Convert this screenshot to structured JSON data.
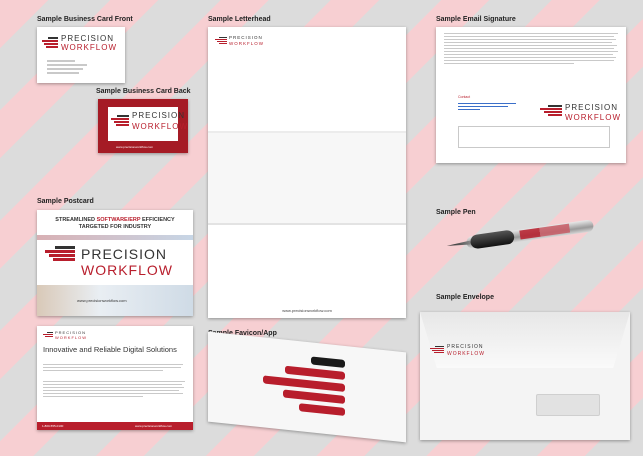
{
  "labels": {
    "card_front": "Sample Business Card Front",
    "card_back": "Sample Business Card Back",
    "letterhead": "Sample Letterhead",
    "email_signature": "Sample Email Signature",
    "postcard": "Sample Postcard",
    "pen": "Sample Pen",
    "envelope": "Sample Envelope",
    "favicon": "Sample Favicon/App"
  },
  "brand": {
    "word1": "PRECISION",
    "word2": "WORKFLOW",
    "website": "www.precisionworkflow.com",
    "colors": {
      "red": "#b81e2c",
      "dark": "#333333"
    }
  },
  "postcard": {
    "headline_pre": "STREAMLINED",
    "headline_accent": "SOFTWARE/ERP",
    "headline_post": "EFFICIENCY",
    "headline_line2": "TARGETED FOR INDUSTRY",
    "url": "www.precisionworkflow.com"
  },
  "flyer": {
    "title": "Innovative and Reliable Digital Solutions",
    "phone": "1-800-555-0100"
  },
  "email_sig": {
    "contact_label": "Contact"
  }
}
